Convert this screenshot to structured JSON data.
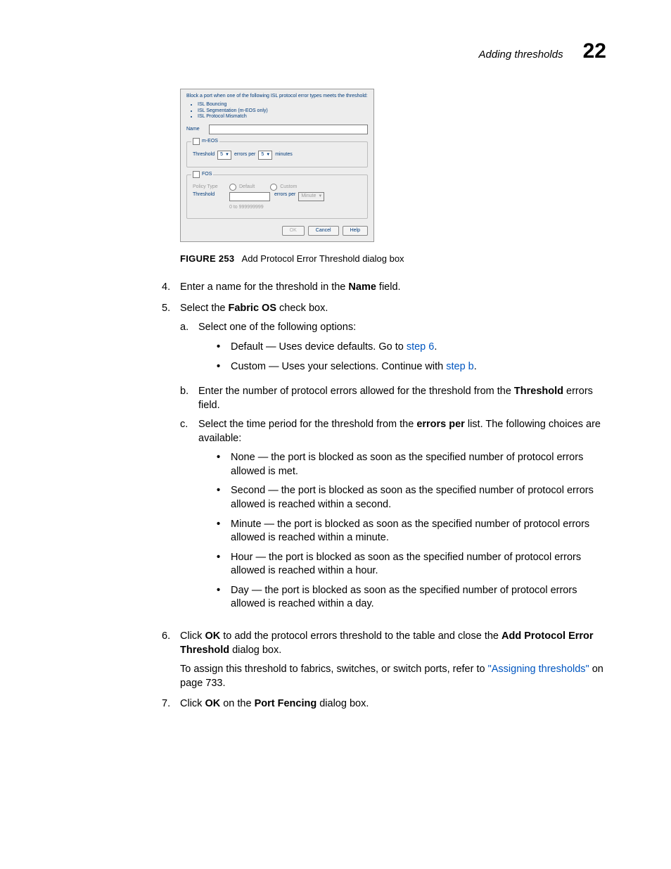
{
  "header": {
    "title": "Adding thresholds",
    "chapter": "22"
  },
  "dialog": {
    "intro": "Block a port when one of the following ISL protocol error types meets the threshold:",
    "bullets": [
      "ISL Bouncing",
      "ISL Segmentation (m-EOS only)",
      "ISL Protocol Mismatch"
    ],
    "name_label": "Name",
    "meos": {
      "title": "m-EOS",
      "threshold_label": "Threshold",
      "threshold_val": "5",
      "errors_per": "errors per",
      "per_val": "5",
      "unit": "minutes"
    },
    "fos": {
      "title": "FOS",
      "policy_label": "Policy Type",
      "default": "Default",
      "custom": "Custom",
      "threshold_label": "Threshold",
      "range": "0 to 999999999",
      "errors_per": "errors per",
      "unit": "Minute"
    },
    "buttons": {
      "ok": "OK",
      "cancel": "Cancel",
      "help": "Help"
    }
  },
  "figure": {
    "prefix": "FIGURE 253",
    "caption": "Add Protocol Error Threshold dialog box"
  },
  "steps": {
    "s4": {
      "num": "4.",
      "t1": "Enter a name for the threshold in the ",
      "b1": "Name",
      "t2": " field."
    },
    "s5": {
      "num": "5.",
      "t1": "Select the ",
      "b1": "Fabric OS",
      "t2": " check box.",
      "a": {
        "snum": "a.",
        "text": "Select one of the following options:",
        "opt1": {
          "t1": "Default — Uses device defaults. Go to ",
          "link": "step 6",
          "t2": "."
        },
        "opt2": {
          "t1": "Custom — Uses your selections. Continue with ",
          "link": "step b",
          "t2": "."
        }
      },
      "b": {
        "snum": "b.",
        "t1": "Enter the number of protocol errors allowed for the threshold from the ",
        "b1": "Threshold",
        "t2": " errors field."
      },
      "c": {
        "snum": "c.",
        "t1": "Select the time period for the threshold from the ",
        "b1": "errors per",
        "t2": " list. The following choices are available:",
        "items": {
          "none": "None — the port is blocked as soon as the specified number of protocol errors allowed is met.",
          "second": "Second — the port is blocked as soon as the specified number of protocol errors allowed is reached within a second.",
          "minute": "Minute — the port is blocked as soon as the specified number of protocol errors allowed is reached within a minute.",
          "hour": "Hour — the port is blocked as soon as the specified number of protocol errors allowed is reached within a hour.",
          "day": "Day — the port is blocked as soon as the specified number of protocol errors allowed is reached within a day."
        }
      }
    },
    "s6": {
      "num": "6.",
      "t1": "Click ",
      "b1": "OK",
      "t2": " to add the protocol errors threshold to the table and close the ",
      "b2": "Add Protocol Error Threshold",
      "t3": " dialog box.",
      "p2a": "To assign this threshold to fabrics, switches, or switch ports, refer to ",
      "link": "\"Assigning thresholds\"",
      "p2b": " on page 733."
    },
    "s7": {
      "num": "7.",
      "t1": "Click ",
      "b1": "OK",
      "t2": " on the ",
      "b2": "Port Fencing",
      "t3": " dialog box."
    }
  }
}
